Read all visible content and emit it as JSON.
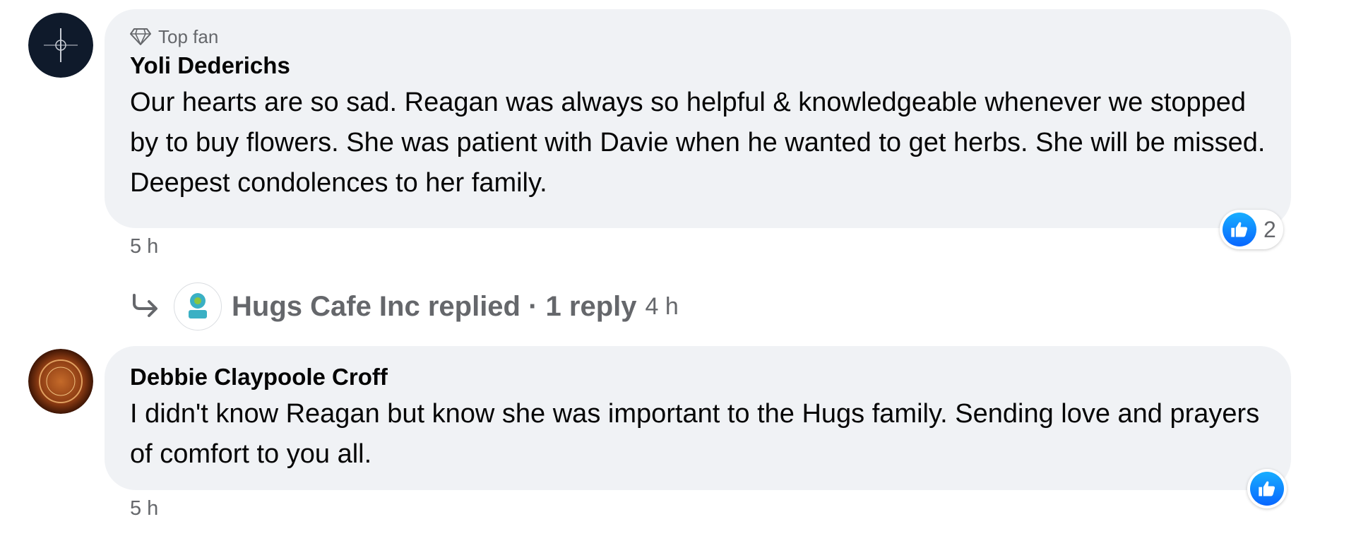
{
  "comments": [
    {
      "badge": "Top fan",
      "author": "Yoli Dederichs",
      "text": "Our hearts are so sad. Reagan was always so helpful & knowledgeable whenever we stopped by to buy flowers. She was patient with Davie when he wanted to get herbs. She will be missed. Deepest condolences to her family.",
      "time": "5 h",
      "reaction_count": "2",
      "reaction": "like-icon",
      "avatar_color": "#0f1a2b"
    },
    {
      "author": "Debbie Claypoole Croff",
      "text": "I didn't know Reagan but know she was important to the Hugs family. Sending love and prayers of comfort to you all.",
      "time": "5 h",
      "reaction": "like-icon",
      "avatar_color": "#8a3a12"
    }
  ],
  "reply_summary": {
    "text": "Hugs Cafe Inc replied · 1 reply",
    "time": "4 h",
    "icon": "reply-arrow-icon"
  },
  "colors": {
    "bubble": "#f0f2f5",
    "like_blue": "#0866ff",
    "muted_text": "#65676b"
  }
}
